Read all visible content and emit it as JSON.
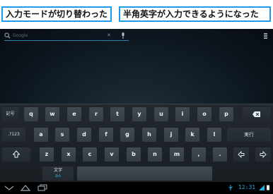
{
  "captions": {
    "left": "入力モードが切り替わった",
    "right": "半角英字が入力できるようになった"
  },
  "search": {
    "placeholder": "Google"
  },
  "keyboard": {
    "row1": [
      "q",
      "w",
      "e",
      "r",
      "t",
      "y",
      "u",
      "i",
      "o",
      "p"
    ],
    "row2": [
      "a",
      "s",
      "d",
      "f",
      "g",
      "h",
      "j",
      "k",
      "l"
    ],
    "row3": [
      "z",
      "x",
      "c",
      "v",
      "b",
      "n",
      "m",
      ",",
      "."
    ],
    "symbol_key": "記号",
    "numpad_key": ".?123",
    "enter_key": "実行",
    "mode_key": "文字",
    "mode_key_sub": "あA"
  },
  "status": {
    "clock": "12:31"
  },
  "colors": {
    "caption_border": "#1e9be8",
    "accent": "#2aa8e0"
  }
}
